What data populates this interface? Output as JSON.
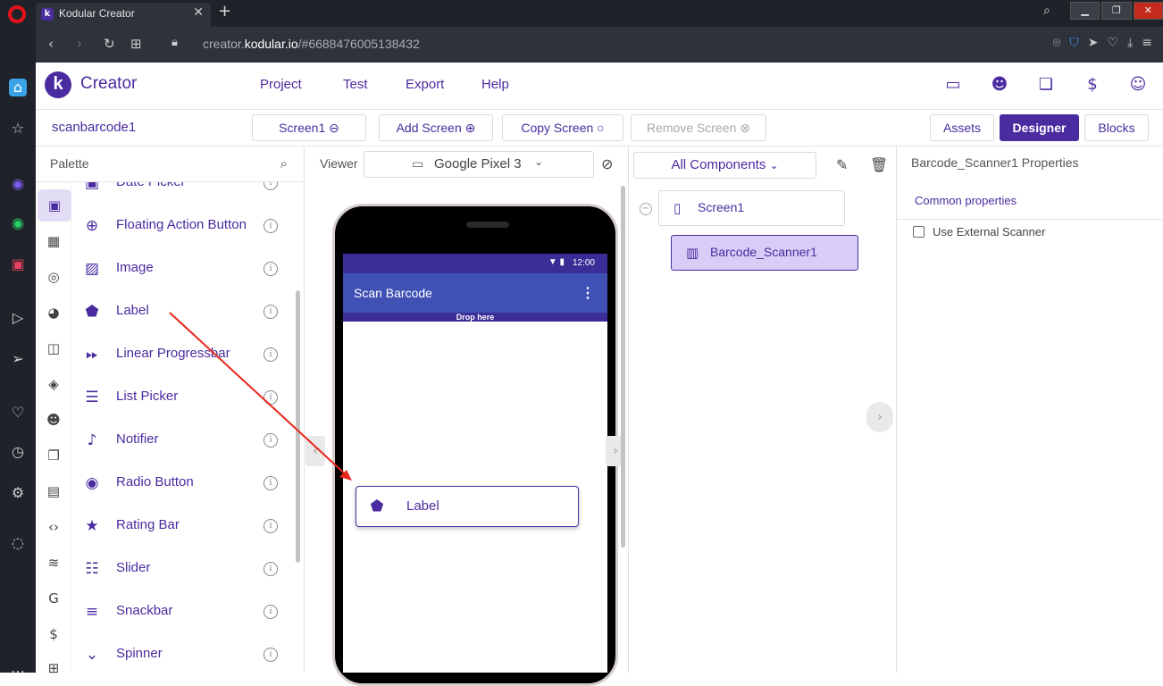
{
  "browser": {
    "tab_title": "Kodular Creator",
    "url_prefix": "creator.",
    "url_domain": "kodular.io",
    "url_path": "/#6688476005138432"
  },
  "app": {
    "logo_letter": "k",
    "logo_text": "Creator",
    "menu": [
      "Project",
      "Test",
      "Export",
      "Help"
    ]
  },
  "toolbar": {
    "project_name": "scanbarcode1",
    "screen_select": "Screen1",
    "add_screen": "Add Screen",
    "copy_screen": "Copy Screen",
    "remove_screen": "Remove Screen",
    "assets": "Assets",
    "designer": "Designer",
    "blocks": "Blocks"
  },
  "palette": {
    "title": "Palette",
    "items": [
      {
        "label": "Date Picker",
        "icon": "calendar-icon"
      },
      {
        "label": "Floating Action Button",
        "icon": "plus-circle-icon"
      },
      {
        "label": "Image",
        "icon": "image-icon"
      },
      {
        "label": "Label",
        "icon": "label-tag-icon"
      },
      {
        "label": "Linear Progressbar",
        "icon": "fast-forward-icon"
      },
      {
        "label": "List Picker",
        "icon": "list-check-icon"
      },
      {
        "label": "Notifier",
        "icon": "bell-icon"
      },
      {
        "label": "Radio Button",
        "icon": "radio-icon"
      },
      {
        "label": "Rating Bar",
        "icon": "star-icon"
      },
      {
        "label": "Slider",
        "icon": "sliders-icon"
      },
      {
        "label": "Snackbar",
        "icon": "snackbar-icon"
      },
      {
        "label": "Spinner",
        "icon": "spinner-icon"
      }
    ]
  },
  "viewer": {
    "label": "Viewer",
    "device": "Google Pixel 3",
    "status_time": "12:00",
    "app_title": "Scan Barcode",
    "drop_here": "Drop here",
    "dragging_label": "Label"
  },
  "components": {
    "filter": "All Components",
    "tree": [
      {
        "label": "Screen1",
        "icon": "phone-icon"
      },
      {
        "label": "Barcode_Scanner1",
        "icon": "barcode-icon"
      }
    ]
  },
  "properties": {
    "title": "Barcode_Scanner1 Properties",
    "section": "Common properties",
    "use_external_scanner": "Use External Scanner",
    "use_external_scanner_checked": false
  },
  "colors": {
    "brand": "#4a2ba0",
    "app_bar": "#3f51b5",
    "selected_node": "#d8cdf6",
    "arrow": "#e8261c"
  }
}
